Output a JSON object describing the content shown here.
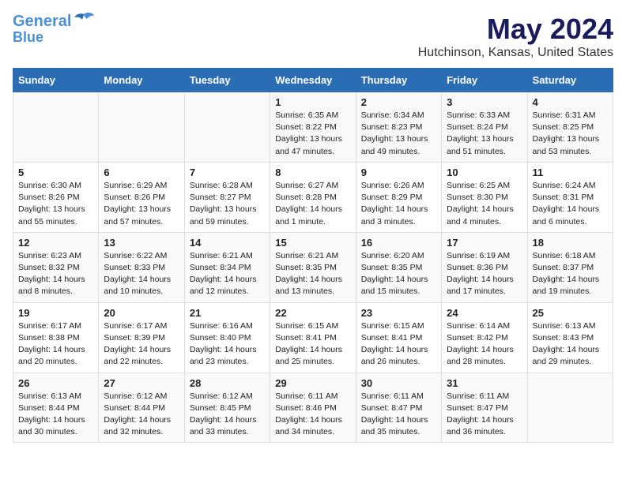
{
  "header": {
    "logo_line1": "General",
    "logo_line2": "Blue",
    "title": "May 2024",
    "subtitle": "Hutchinson, Kansas, United States"
  },
  "days_of_week": [
    "Sunday",
    "Monday",
    "Tuesday",
    "Wednesday",
    "Thursday",
    "Friday",
    "Saturday"
  ],
  "weeks": [
    [
      {
        "day": "",
        "info": ""
      },
      {
        "day": "",
        "info": ""
      },
      {
        "day": "",
        "info": ""
      },
      {
        "day": "1",
        "info": "Sunrise: 6:35 AM\nSunset: 8:22 PM\nDaylight: 13 hours\nand 47 minutes."
      },
      {
        "day": "2",
        "info": "Sunrise: 6:34 AM\nSunset: 8:23 PM\nDaylight: 13 hours\nand 49 minutes."
      },
      {
        "day": "3",
        "info": "Sunrise: 6:33 AM\nSunset: 8:24 PM\nDaylight: 13 hours\nand 51 minutes."
      },
      {
        "day": "4",
        "info": "Sunrise: 6:31 AM\nSunset: 8:25 PM\nDaylight: 13 hours\nand 53 minutes."
      }
    ],
    [
      {
        "day": "5",
        "info": "Sunrise: 6:30 AM\nSunset: 8:26 PM\nDaylight: 13 hours\nand 55 minutes."
      },
      {
        "day": "6",
        "info": "Sunrise: 6:29 AM\nSunset: 8:26 PM\nDaylight: 13 hours\nand 57 minutes."
      },
      {
        "day": "7",
        "info": "Sunrise: 6:28 AM\nSunset: 8:27 PM\nDaylight: 13 hours\nand 59 minutes."
      },
      {
        "day": "8",
        "info": "Sunrise: 6:27 AM\nSunset: 8:28 PM\nDaylight: 14 hours\nand 1 minute."
      },
      {
        "day": "9",
        "info": "Sunrise: 6:26 AM\nSunset: 8:29 PM\nDaylight: 14 hours\nand 3 minutes."
      },
      {
        "day": "10",
        "info": "Sunrise: 6:25 AM\nSunset: 8:30 PM\nDaylight: 14 hours\nand 4 minutes."
      },
      {
        "day": "11",
        "info": "Sunrise: 6:24 AM\nSunset: 8:31 PM\nDaylight: 14 hours\nand 6 minutes."
      }
    ],
    [
      {
        "day": "12",
        "info": "Sunrise: 6:23 AM\nSunset: 8:32 PM\nDaylight: 14 hours\nand 8 minutes."
      },
      {
        "day": "13",
        "info": "Sunrise: 6:22 AM\nSunset: 8:33 PM\nDaylight: 14 hours\nand 10 minutes."
      },
      {
        "day": "14",
        "info": "Sunrise: 6:21 AM\nSunset: 8:34 PM\nDaylight: 14 hours\nand 12 minutes."
      },
      {
        "day": "15",
        "info": "Sunrise: 6:21 AM\nSunset: 8:35 PM\nDaylight: 14 hours\nand 13 minutes."
      },
      {
        "day": "16",
        "info": "Sunrise: 6:20 AM\nSunset: 8:35 PM\nDaylight: 14 hours\nand 15 minutes."
      },
      {
        "day": "17",
        "info": "Sunrise: 6:19 AM\nSunset: 8:36 PM\nDaylight: 14 hours\nand 17 minutes."
      },
      {
        "day": "18",
        "info": "Sunrise: 6:18 AM\nSunset: 8:37 PM\nDaylight: 14 hours\nand 19 minutes."
      }
    ],
    [
      {
        "day": "19",
        "info": "Sunrise: 6:17 AM\nSunset: 8:38 PM\nDaylight: 14 hours\nand 20 minutes."
      },
      {
        "day": "20",
        "info": "Sunrise: 6:17 AM\nSunset: 8:39 PM\nDaylight: 14 hours\nand 22 minutes."
      },
      {
        "day": "21",
        "info": "Sunrise: 6:16 AM\nSunset: 8:40 PM\nDaylight: 14 hours\nand 23 minutes."
      },
      {
        "day": "22",
        "info": "Sunrise: 6:15 AM\nSunset: 8:41 PM\nDaylight: 14 hours\nand 25 minutes."
      },
      {
        "day": "23",
        "info": "Sunrise: 6:15 AM\nSunset: 8:41 PM\nDaylight: 14 hours\nand 26 minutes."
      },
      {
        "day": "24",
        "info": "Sunrise: 6:14 AM\nSunset: 8:42 PM\nDaylight: 14 hours\nand 28 minutes."
      },
      {
        "day": "25",
        "info": "Sunrise: 6:13 AM\nSunset: 8:43 PM\nDaylight: 14 hours\nand 29 minutes."
      }
    ],
    [
      {
        "day": "26",
        "info": "Sunrise: 6:13 AM\nSunset: 8:44 PM\nDaylight: 14 hours\nand 30 minutes."
      },
      {
        "day": "27",
        "info": "Sunrise: 6:12 AM\nSunset: 8:44 PM\nDaylight: 14 hours\nand 32 minutes."
      },
      {
        "day": "28",
        "info": "Sunrise: 6:12 AM\nSunset: 8:45 PM\nDaylight: 14 hours\nand 33 minutes."
      },
      {
        "day": "29",
        "info": "Sunrise: 6:11 AM\nSunset: 8:46 PM\nDaylight: 14 hours\nand 34 minutes."
      },
      {
        "day": "30",
        "info": "Sunrise: 6:11 AM\nSunset: 8:47 PM\nDaylight: 14 hours\nand 35 minutes."
      },
      {
        "day": "31",
        "info": "Sunrise: 6:11 AM\nSunset: 8:47 PM\nDaylight: 14 hours\nand 36 minutes."
      },
      {
        "day": "",
        "info": ""
      }
    ]
  ]
}
